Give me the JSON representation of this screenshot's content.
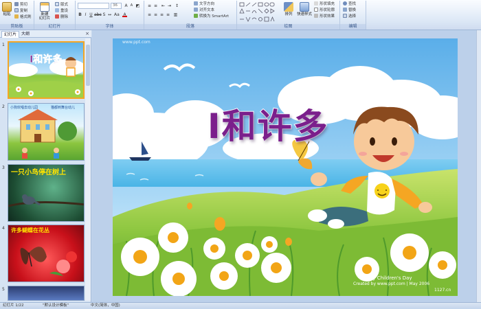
{
  "ribbon": {
    "clipboard": {
      "paste": "粘贴",
      "cut": "剪切",
      "copy": "复制",
      "format_painter": "格式刷",
      "label": "剪贴板"
    },
    "slides": {
      "new_slide": "新建\n幻灯片",
      "layout": "版式",
      "reset": "重设",
      "delete": "删除",
      "label": "幻灯片"
    },
    "font": {
      "font_name": "",
      "font_size": "36",
      "bold": "B",
      "italic": "I",
      "underline": "U",
      "label": "字体"
    },
    "paragraph": {
      "text_direction": "文字方向",
      "align_text": "对齐文本",
      "convert_smartart": "转换为 SmartArt",
      "label": "段落"
    },
    "drawing": {
      "arrange": "排列",
      "quick_styles": "快速样式",
      "shape_fill": "形状填充",
      "shape_outline": "形状轮廓",
      "shape_effects": "形状效果",
      "label": "绘图"
    },
    "editing": {
      "find": "查找",
      "replace": "替换",
      "select": "选择",
      "label": "编辑"
    }
  },
  "panel": {
    "tab_slides": "幻灯片",
    "tab_outline": "大纲",
    "close": "×",
    "slides": [
      {
        "num": "1",
        "title": "I和许多"
      },
      {
        "num": "2",
        "caption_left": "小狗欢唱去动儿园",
        "caption_right": "猫都到舞台动儿"
      },
      {
        "num": "3",
        "title": "一只小鸟停在树上"
      },
      {
        "num": "4",
        "title": "许多蝴蝶在花丛"
      },
      {
        "num": "5"
      }
    ]
  },
  "slide": {
    "title": "I和许多",
    "watermark": "www.ppt.com",
    "credit_line1": "Happy Children's Day",
    "credit_line2": "Created by www.ppt.com | May 2006",
    "credit_line3": "1127.cn"
  },
  "status": {
    "slide_counter": "幻灯片 1/22",
    "theme": "\"默认设计模板\"",
    "language": "中文(简体，中国)"
  },
  "colors": {
    "title_purple": "#7b1f8c",
    "sky_blue": "#7fc0ee",
    "grass_green": "#8cc63f",
    "selection_orange": "#f5a623"
  }
}
